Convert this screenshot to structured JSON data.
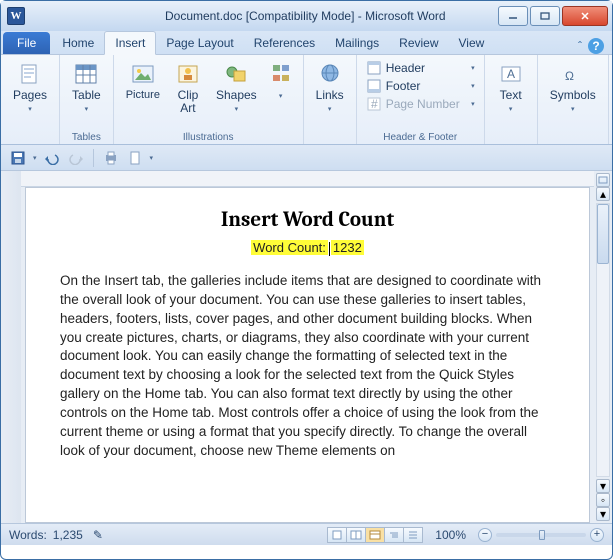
{
  "window": {
    "app_letter": "W",
    "title": "Document.doc [Compatibility Mode] - Microsoft Word"
  },
  "tabs": {
    "file": "File",
    "items": [
      "Home",
      "Insert",
      "Page Layout",
      "References",
      "Mailings",
      "Review",
      "View"
    ],
    "active_index": 1,
    "help_glyph": "?"
  },
  "ribbon": {
    "groups": {
      "pages": {
        "label": "",
        "btn": "Pages"
      },
      "tables": {
        "label": "Tables",
        "btn": "Table"
      },
      "illustrations": {
        "label": "Illustrations",
        "picture": "Picture",
        "clipart_l1": "Clip",
        "clipart_l2": "Art",
        "shapes": "Shapes"
      },
      "links": {
        "label": "",
        "btn": "Links"
      },
      "headerfooter": {
        "label": "Header & Footer",
        "hdr": "Header",
        "ftr": "Footer",
        "pg": "Page Number"
      },
      "text": {
        "label": "",
        "btn": "Text"
      },
      "symbols": {
        "label": "",
        "btn": "Symbols"
      }
    }
  },
  "document": {
    "heading": "Insert Word Count",
    "wc_label": "Word Count:",
    "wc_value": "1232",
    "body": "On the Insert tab, the galleries include items that are designed to coordinate with the overall look of your document. You can use these galleries to insert tables, headers, footers, lists, cover pages, and other document building blocks. When you create pictures, charts, or diagrams, they also coordinate with your current document look. You can easily change the formatting of selected text in the document text by choosing a look for the selected text from the Quick Styles gallery on the Home tab. You can also format text directly by using the other controls on the Home tab. Most controls offer a choice of using the look from the current theme or using a format that you specify directly. To change the overall look of your document, choose new Theme elements on"
  },
  "status": {
    "words_label": "Words:",
    "words_value": "1,235",
    "zoom": "100%"
  }
}
